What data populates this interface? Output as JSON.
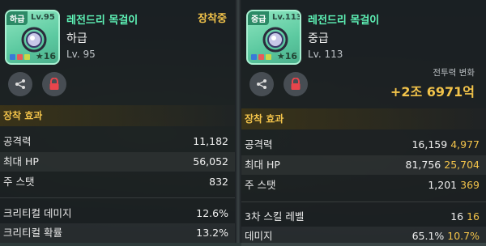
{
  "left_panel": {
    "icon": {
      "grade_tag": "하급",
      "level_tag": "Lv.95",
      "star_level": "16",
      "icon_name": "necklace-gem-icon"
    },
    "item_name": "레전드리 목걸이",
    "grade": "하급",
    "level": "Lv. 95",
    "status": "장착중",
    "section_title": "장착 효과",
    "stats": [
      {
        "label": "공격력",
        "value": "11,182"
      },
      {
        "label": "최대 HP",
        "value": "56,052"
      },
      {
        "label": "주 스탯",
        "value": "832"
      },
      {
        "label": "크리티컬 데미지",
        "value": "12.6%"
      },
      {
        "label": "크리티컬 확률",
        "value": "13.2%"
      }
    ]
  },
  "right_panel": {
    "icon": {
      "grade_tag": "중급",
      "level_tag": "Lv.113",
      "star_level": "16",
      "icon_name": "necklace-gem-icon"
    },
    "item_name": "레전드리 목걸이",
    "grade": "중급",
    "level": "Lv. 113",
    "power_change_label": "전투력 변화",
    "power_change_value": "+2조 6971억",
    "section_title": "장착 효과",
    "stats": [
      {
        "label": "공격력",
        "value": "16,159",
        "bonus": "4,977"
      },
      {
        "label": "최대 HP",
        "value": "81,756",
        "bonus": "25,704"
      },
      {
        "label": "주 스탯",
        "value": "1,201",
        "bonus": "369"
      },
      {
        "label": "3차 스킬 레벨",
        "value": "16",
        "bonus": "16"
      },
      {
        "label": "데미지",
        "value": "65.1%",
        "bonus": "10.7%"
      }
    ]
  },
  "icons": {
    "share": "share-icon",
    "lock": "lock-icon"
  },
  "colors": {
    "accent_gold": "#f2c34a",
    "item_name_green": "#5ff5b8",
    "lock_red": "#e8454c"
  }
}
